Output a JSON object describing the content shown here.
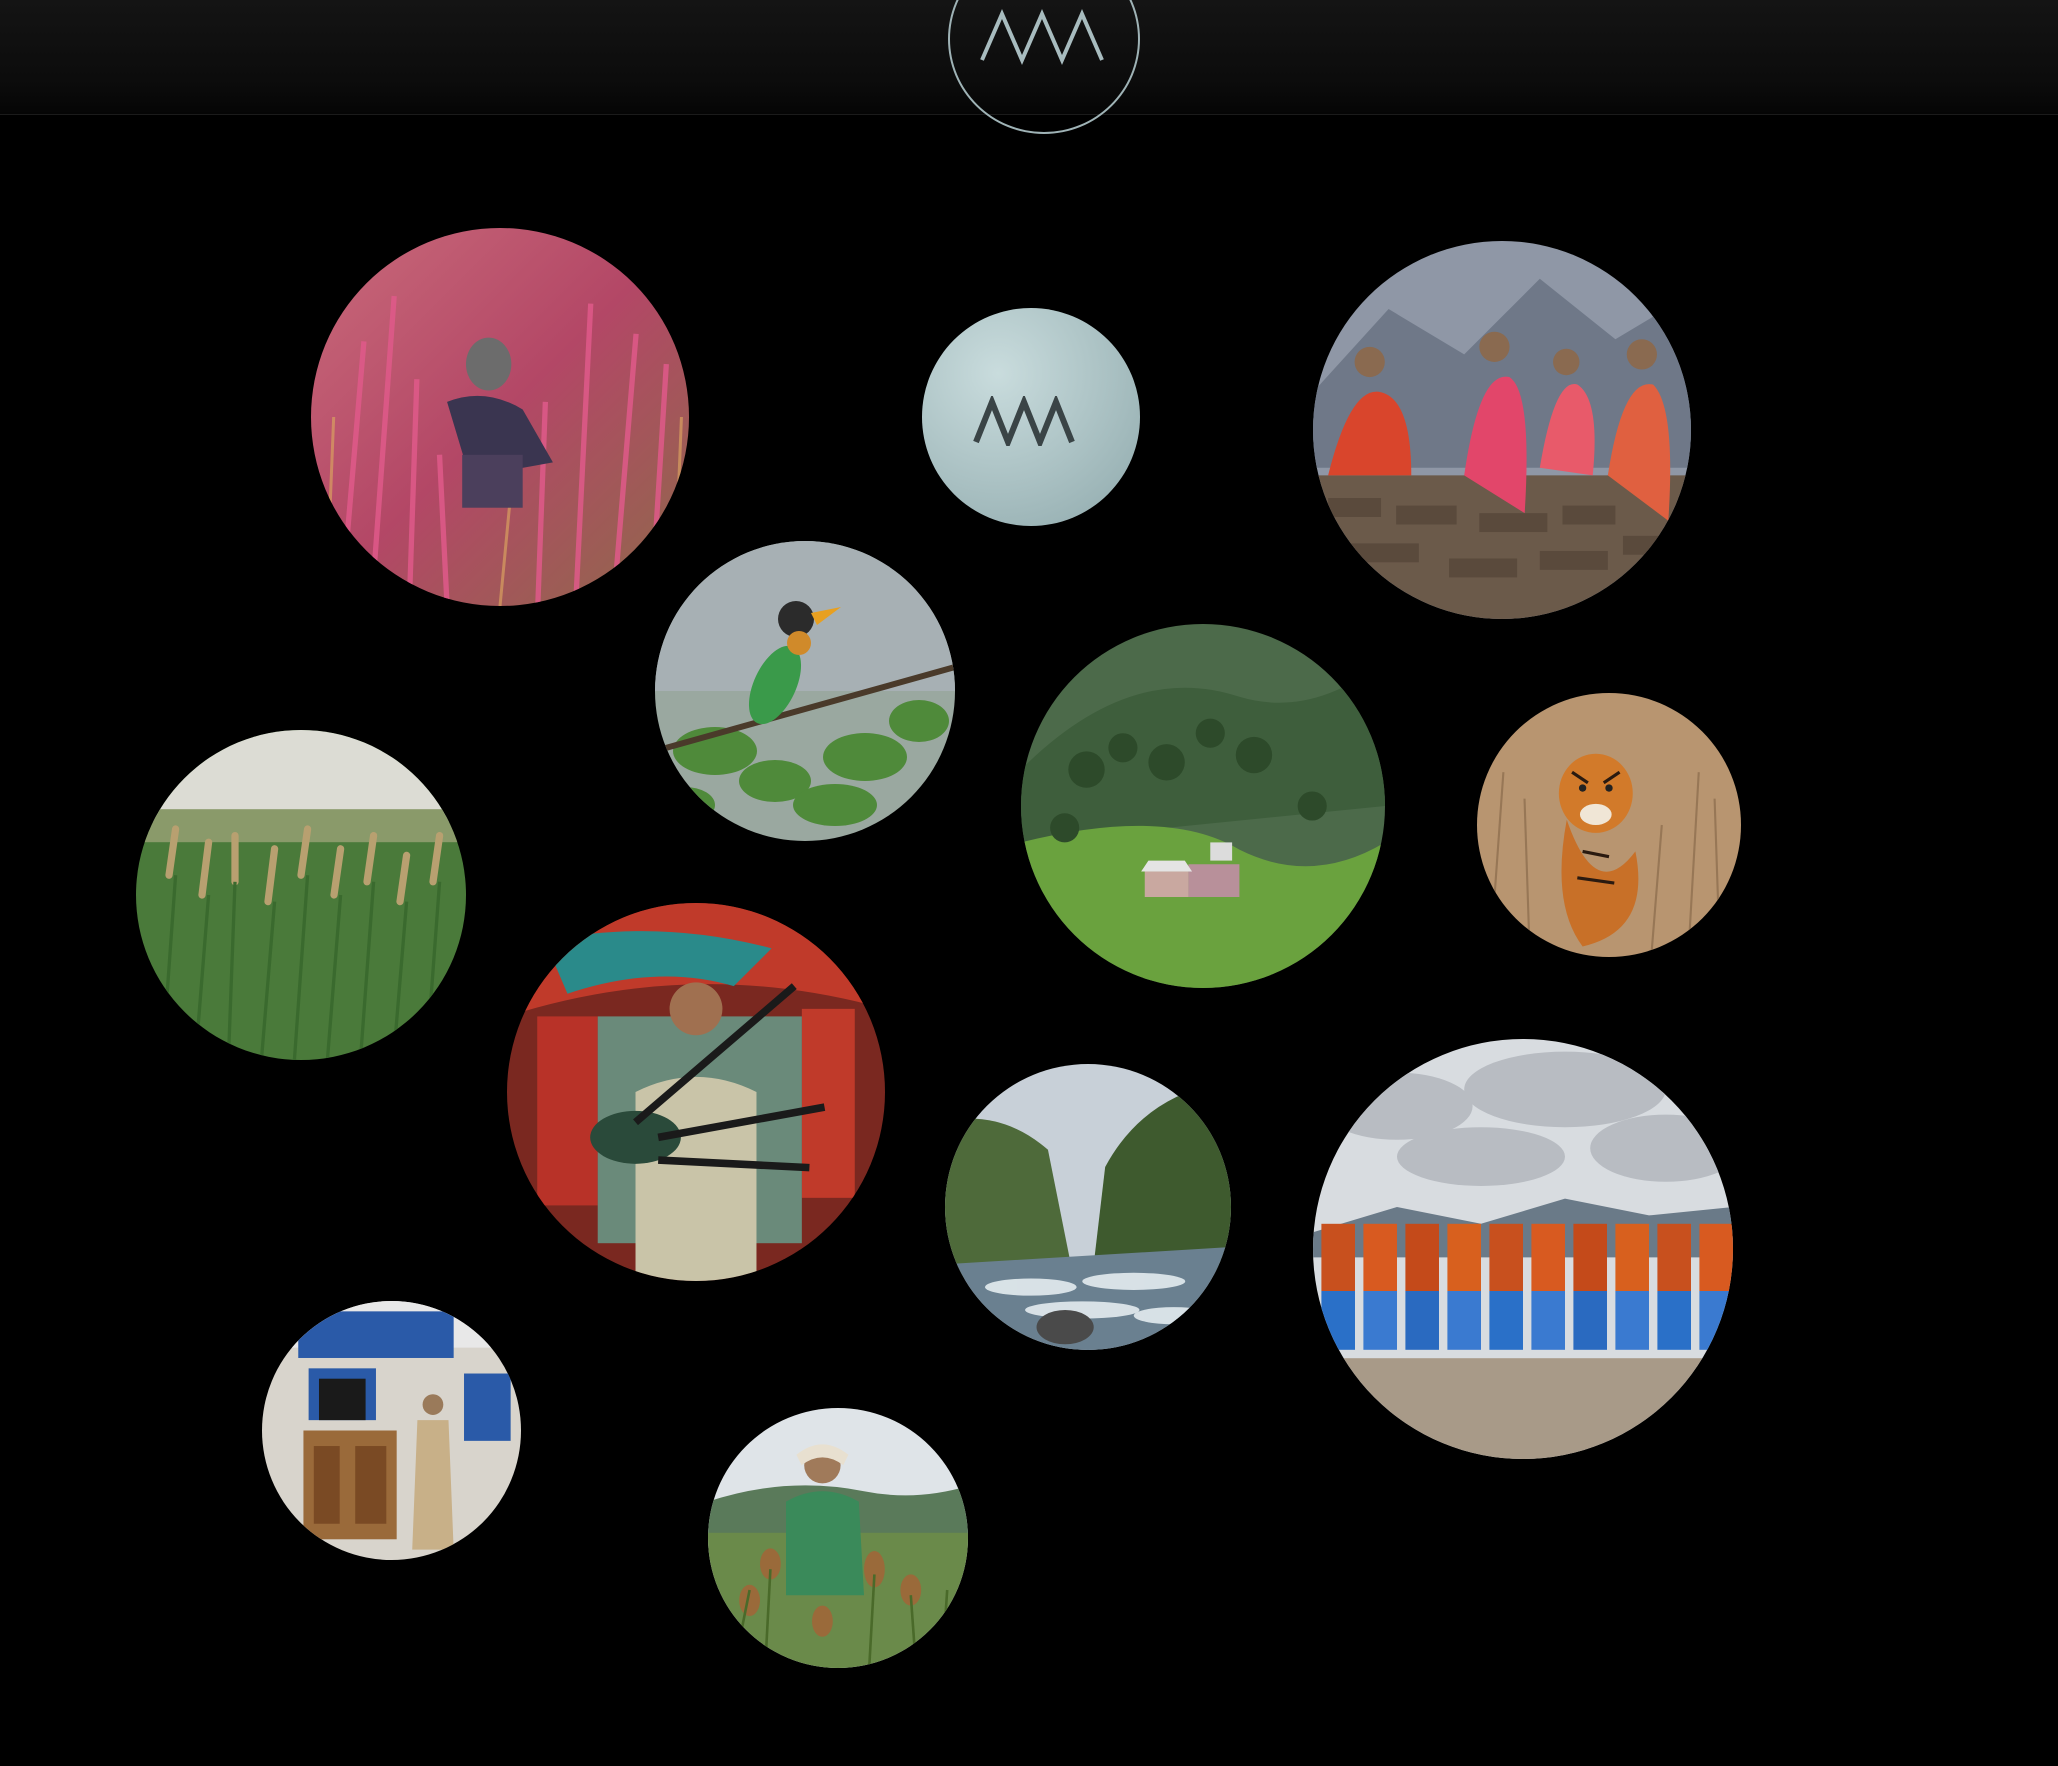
{
  "header": {
    "logo_icon": "mountain-wave-logo-icon",
    "accent": "#9fb3b6"
  },
  "gallery": {
    "center_logo_icon": "mountain-wave-logo-icon",
    "items": [
      {
        "name": "photo-woman-amaranth-field",
        "subject": "woman-in-amaranth-field"
      },
      {
        "name": "photo-women-sitting-on-wall",
        "subject": "women-sitting-on-stone-wall"
      },
      {
        "name": "photo-barbet-bird",
        "subject": "bird-on-branch"
      },
      {
        "name": "photo-hill-village",
        "subject": "village-on-forested-hill"
      },
      {
        "name": "photo-tiger",
        "subject": "tiger-in-grass"
      },
      {
        "name": "photo-millet-field",
        "subject": "millet-field"
      },
      {
        "name": "photo-bagpiper",
        "subject": "man-playing-bagpipes"
      },
      {
        "name": "photo-river-gorge",
        "subject": "river-in-gorge"
      },
      {
        "name": "photo-women-dancing",
        "subject": "women-in-traditional-dress"
      },
      {
        "name": "photo-man-at-house",
        "subject": "man-by-carved-doorway"
      },
      {
        "name": "photo-woman-harvest",
        "subject": "woman-harvesting-grain"
      }
    ]
  }
}
